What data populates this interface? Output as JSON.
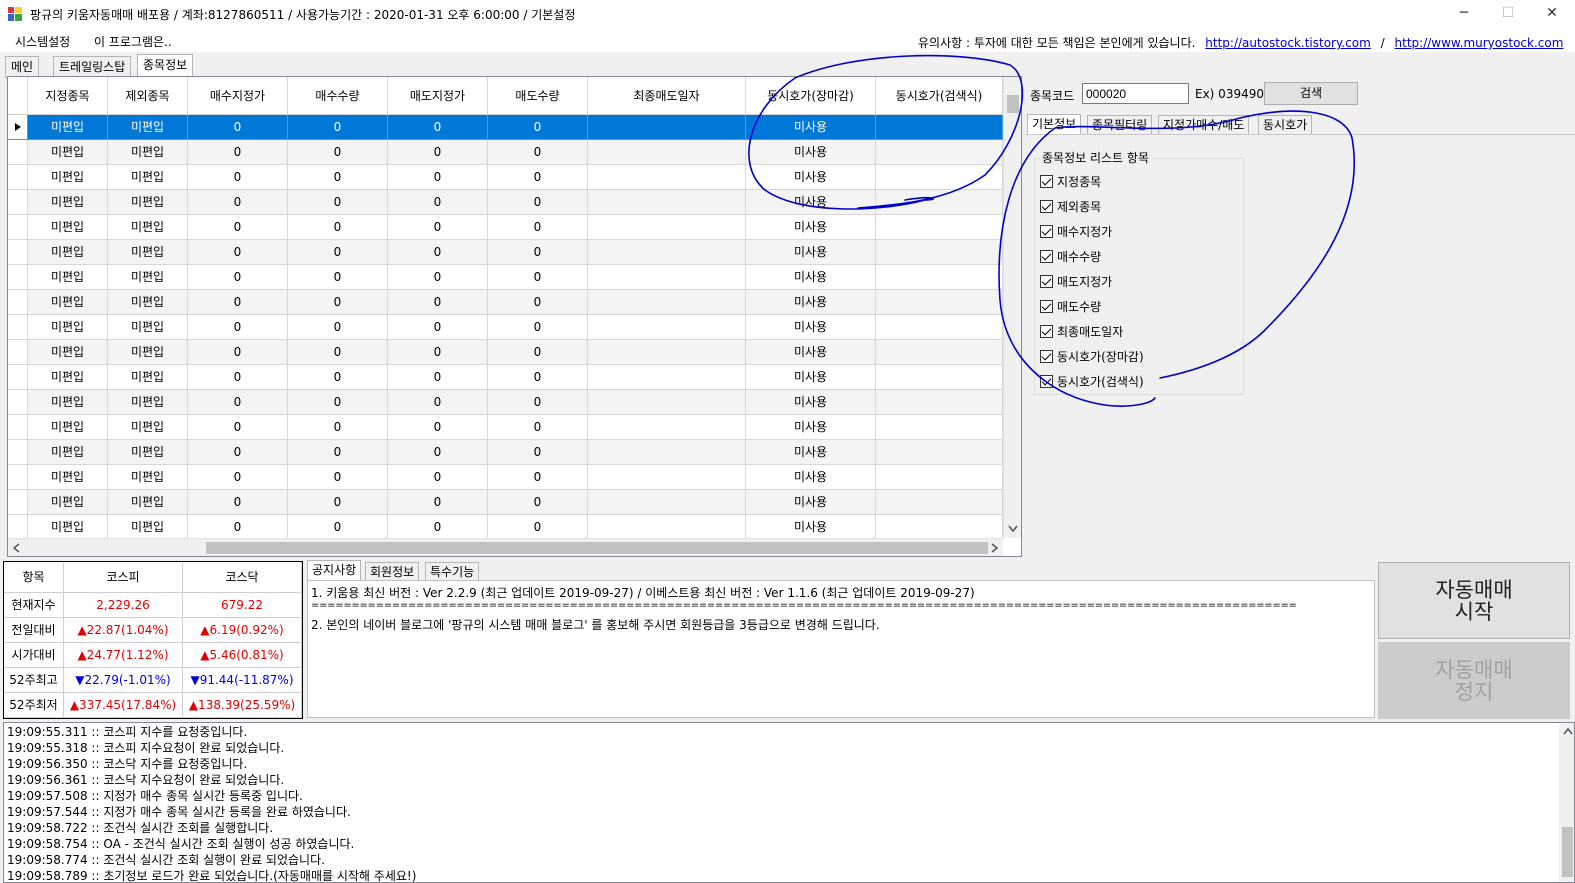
{
  "window": {
    "title": "팡규의 키움자동매매 배포용 / 계좌:8127860511 / 사용가능기간 : 2020-01-31 오후 6:00:00 / 기본설정",
    "minimize": "─",
    "maximize": "☐",
    "close": "✕"
  },
  "menu": {
    "items": [
      "시스템설정",
      "이 프로그램은.."
    ],
    "notice_label": "유의사항 : 투자에 대한 모든 책임은 본인에게 있습니다.",
    "link1": "http://autostock.tistory.com",
    "separator": "/",
    "link2": "http://www.muryostock.com"
  },
  "main_tabs": [
    "메인",
    "트레일링스탑",
    "종목정보"
  ],
  "grid": {
    "columns": [
      "지정종목",
      "제외종목",
      "매수지정가",
      "매수수량",
      "매도지정가",
      "매도수량",
      "최종매도일자",
      "동시호가(장마감)",
      "동시호가(검색식)"
    ],
    "row_values": [
      "미편입",
      "미편입",
      "0",
      "0",
      "0",
      "0",
      "",
      "미사용",
      ""
    ],
    "row_count": 17
  },
  "search": {
    "label": "종목코드",
    "value": "000020",
    "example": "Ex) 039490",
    "button": "검색"
  },
  "sub_tabs": [
    "기본정보",
    "종목필터링",
    "지정가매수/매도",
    "동시호가"
  ],
  "list_group": {
    "title": "종목정보 리스트 항목",
    "items": [
      "지정종목",
      "제외종목",
      "매수지정가",
      "매수수량",
      "매도지정가",
      "매도수량",
      "최종매도일자",
      "동시호가(장마감)",
      "동시호가(검색식)"
    ]
  },
  "index_table": {
    "headers": [
      "항목",
      "코스피",
      "코스닥"
    ],
    "rows": [
      {
        "label": "현재지수",
        "kospi": "2,229.26",
        "kosdaq": "679.22",
        "kospi_color": "red",
        "kosdaq_color": "red"
      },
      {
        "label": "전일대비",
        "kospi": "▲22.87(1.04%)",
        "kosdaq": "▲6.19(0.92%)",
        "kospi_color": "red",
        "kosdaq_color": "red"
      },
      {
        "label": "시가대비",
        "kospi": "▲24.77(1.12%)",
        "kosdaq": "▲5.46(0.81%)",
        "kospi_color": "red",
        "kosdaq_color": "red"
      },
      {
        "label": "52주최고",
        "kospi": "▼22.79(-1.01%)",
        "kosdaq": "▼91.44(-11.87%)",
        "kospi_color": "blue",
        "kosdaq_color": "blue"
      },
      {
        "label": "52주최저",
        "kospi": "▲337.45(17.84%)",
        "kosdaq": "▲138.39(25.59%)",
        "kospi_color": "red",
        "kosdaq_color": "red"
      }
    ]
  },
  "notice_tabs": [
    "공지사항",
    "회원정보",
    "특수기능"
  ],
  "notice_lines": [
    "1. 키움용 최신 버전 : Ver 2.2.9 (최근 업데이트 2019-09-27) / 이베스트용 최신 버전 : Ver 1.1.6 (최근 업데이트 2019-09-27)",
    "==========================================================================================================================",
    "2. 본인의 네이버 블로그에 '팡규의 시스템 매매 블로그' 를 홍보해 주시면 회원등급을 3등급으로 변경해 드립니다."
  ],
  "buttons": {
    "start_line1": "자동매매",
    "start_line2": "시작",
    "stop_line1": "자동매매",
    "stop_line2": "정지"
  },
  "log_lines": [
    "19:09:55.311 :: 코스피 지수를 요청중입니다.",
    "19:09:55.318 :: 코스피 지수요청이 완료 되었습니다.",
    "19:09:56.350 :: 코스닥 지수를 요청중입니다.",
    "19:09:56.361 :: 코스닥 지수요청이 완료 되었습니다.",
    "19:09:57.508 :: 지정가 매수 종목 실시간 등록중 입니다.",
    "19:09:57.544 :: 지정가 매수 종목 실시간 등록을 완료 하였습니다.",
    "19:09:58.722 :: 조건식 실시간 조회를 실행합니다.",
    "19:09:58.754 :: OA - 조건식 실시간 조회 실행이 성공 하였습니다.",
    "19:09:58.774 :: 조건식 실시간 조회 실행이 완료 되었습니다.",
    "19:09:58.789 :: 초기정보 로드가 완료 되었습니다.(자동매매를 시작해 주세요!)"
  ],
  "colors": {
    "selection": "#0078d7",
    "annotation": "#0000cc",
    "up": "#e00000",
    "down": "#0000e0"
  }
}
